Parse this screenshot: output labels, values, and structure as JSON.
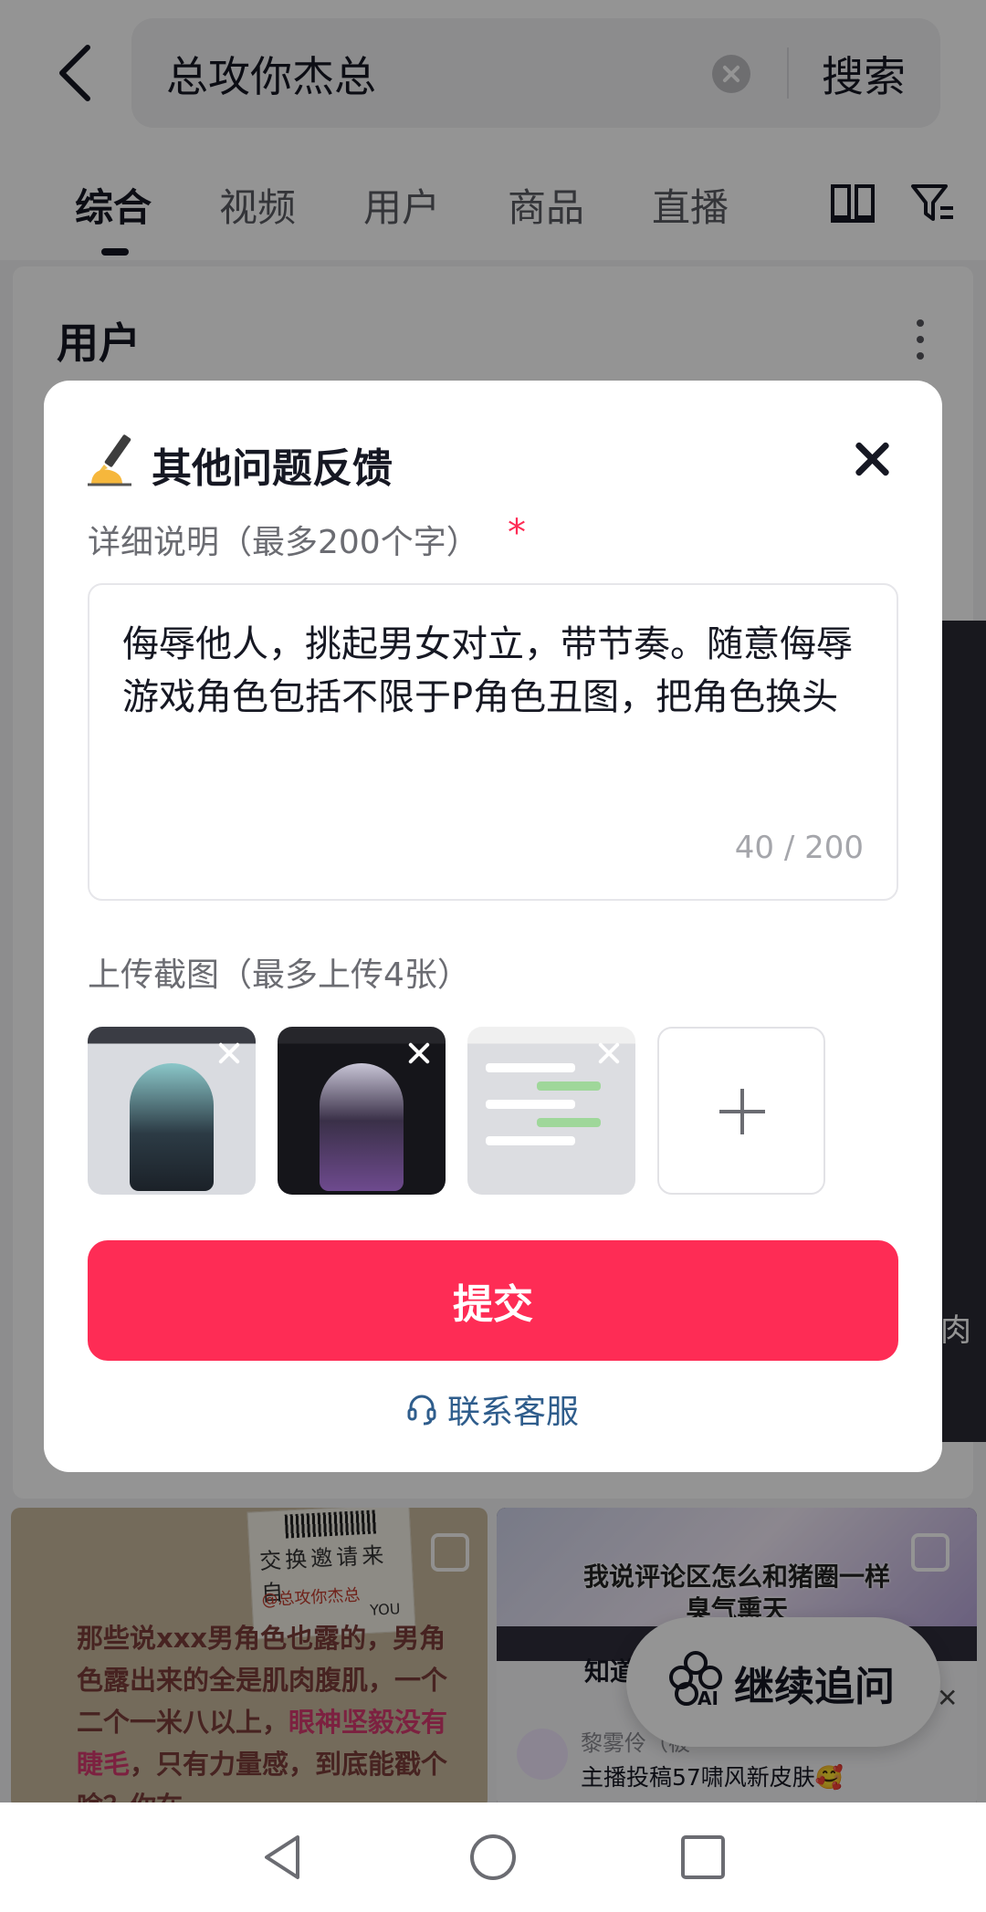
{
  "header": {
    "search_query": "总攻你杰总",
    "search_button": "搜索"
  },
  "tabs": [
    {
      "label": "综合",
      "active": true
    },
    {
      "label": "视频",
      "active": false
    },
    {
      "label": "用户",
      "active": false
    },
    {
      "label": "商品",
      "active": false
    },
    {
      "label": "直播",
      "active": false
    }
  ],
  "section": {
    "title": "用户"
  },
  "background_cards": {
    "left": {
      "ticket_text": "交换邀请来自",
      "ticket_sign": "@总攻你杰总",
      "ticket_you": "YOU",
      "text_part1": "那些说xxx男角色也露的，男角色露出来的全是肌肉腹肌，一个二个一米八以上，",
      "text_pink": "眼神坚毅没有睫毛",
      "text_part2": "，只有力量感，到底能戳个啥？你在"
    },
    "right": {
      "caption_line1": "我说评论区怎么和猪圈一样",
      "caption_line2": "臭气熏天",
      "prefix": "知道",
      "author": "黎雾伶（被",
      "post": "主播投稿57啸风新皮肤🥰"
    },
    "right_strip_text": "肉"
  },
  "continue_pill": {
    "icon_text": "AI",
    "label": "继续追问"
  },
  "modal": {
    "title_emoji": "✍️",
    "title": "其他问题反馈",
    "detail_label": "详细说明（最多200个字）",
    "required_mark": "*",
    "description": "侮辱他人，挑起男女对立，带节奏。随意侮辱游戏角色包括不限于P角色丑图，把角色换头",
    "char_count": "40 / 200",
    "upload_label": "上传截图（最多上传4张）",
    "submit_label": "提交",
    "contact_label": "联系客服"
  },
  "colors": {
    "accent": "#fe2c55",
    "link": "#2f5d8c",
    "overlay": "rgba(0,0,0,0.42)"
  }
}
